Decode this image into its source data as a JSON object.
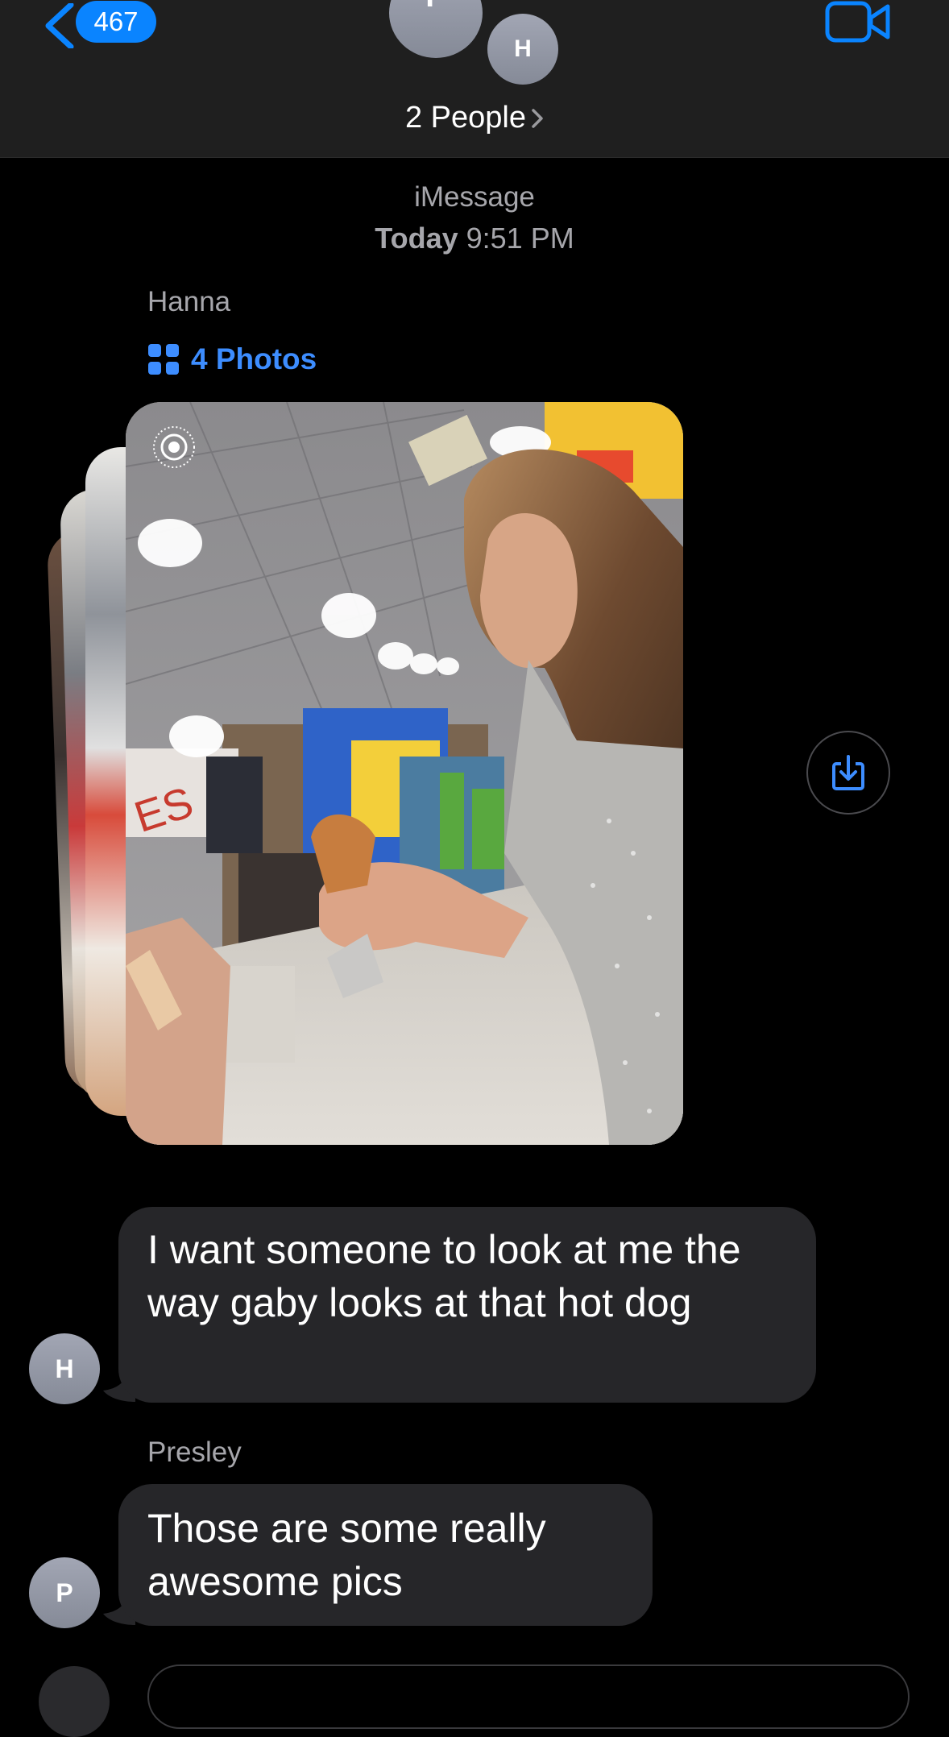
{
  "header": {
    "back_count": "467",
    "avatars": [
      {
        "initial": "P"
      },
      {
        "initial": "H"
      }
    ],
    "people_label": "2 People",
    "icons": {
      "back": "chevron-left-icon",
      "people": "chevron-right-icon",
      "video": "video-camera-icon"
    },
    "accent_color": "#0a84ff"
  },
  "thread": {
    "service": "iMessage",
    "day": "Today",
    "time": "9:51 PM"
  },
  "messages": [
    {
      "sender": "Hanna",
      "avatar_initial": "H",
      "attachment": {
        "label": "4 Photos",
        "icon": "photo-grid-icon",
        "count": 4,
        "live_photo_icon": "live-photo-icon",
        "save_icon": "download-icon"
      },
      "text": "I want someone to look at me the way gaby looks at that hot dog"
    },
    {
      "sender": "Presley",
      "avatar_initial": "P",
      "text": "Those are some really awesome pics"
    }
  ]
}
